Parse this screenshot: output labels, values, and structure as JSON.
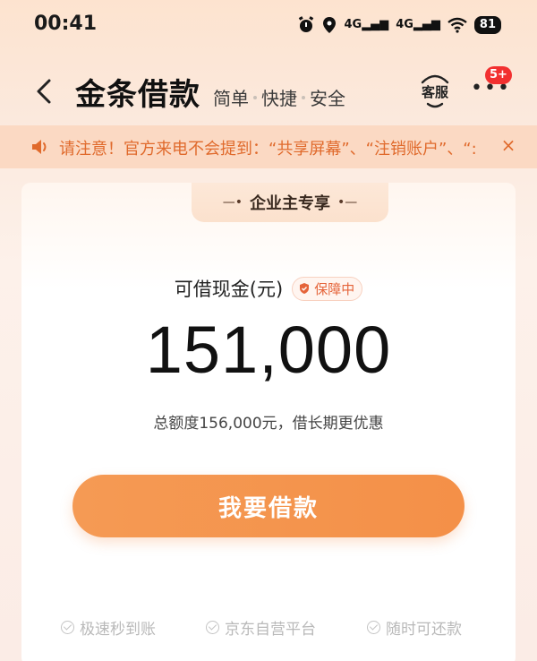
{
  "status_bar": {
    "time": "00:41",
    "network_label_1": "4G",
    "network_label_2": "4G",
    "battery": "81",
    "icons": [
      "alarm-icon",
      "location-icon",
      "signal-icon",
      "signal-icon",
      "wifi-icon",
      "battery-icon"
    ]
  },
  "header": {
    "title": "金条借款",
    "subtitle_parts": [
      "简单",
      "快捷",
      "安全"
    ],
    "service_label": "客服",
    "more_badge": "5+"
  },
  "notice": {
    "text": "请注意！官方来电不会提到：“共享屏幕”、“注销账户”、“:",
    "close": "×"
  },
  "card": {
    "tag": "企业主专享",
    "cash_label": "可借现金(元)",
    "guard_badge": "保障中",
    "amount": "151,000",
    "limit_note": "总额度156,000元，借长期更优惠",
    "borrow_button": "我要借款",
    "features": [
      "极速秒到账",
      "京东自营平台",
      "随时可还款"
    ]
  },
  "colors": {
    "accent": "#f59a54",
    "notice_text": "#e06a2c",
    "badge_red": "#f23030"
  }
}
